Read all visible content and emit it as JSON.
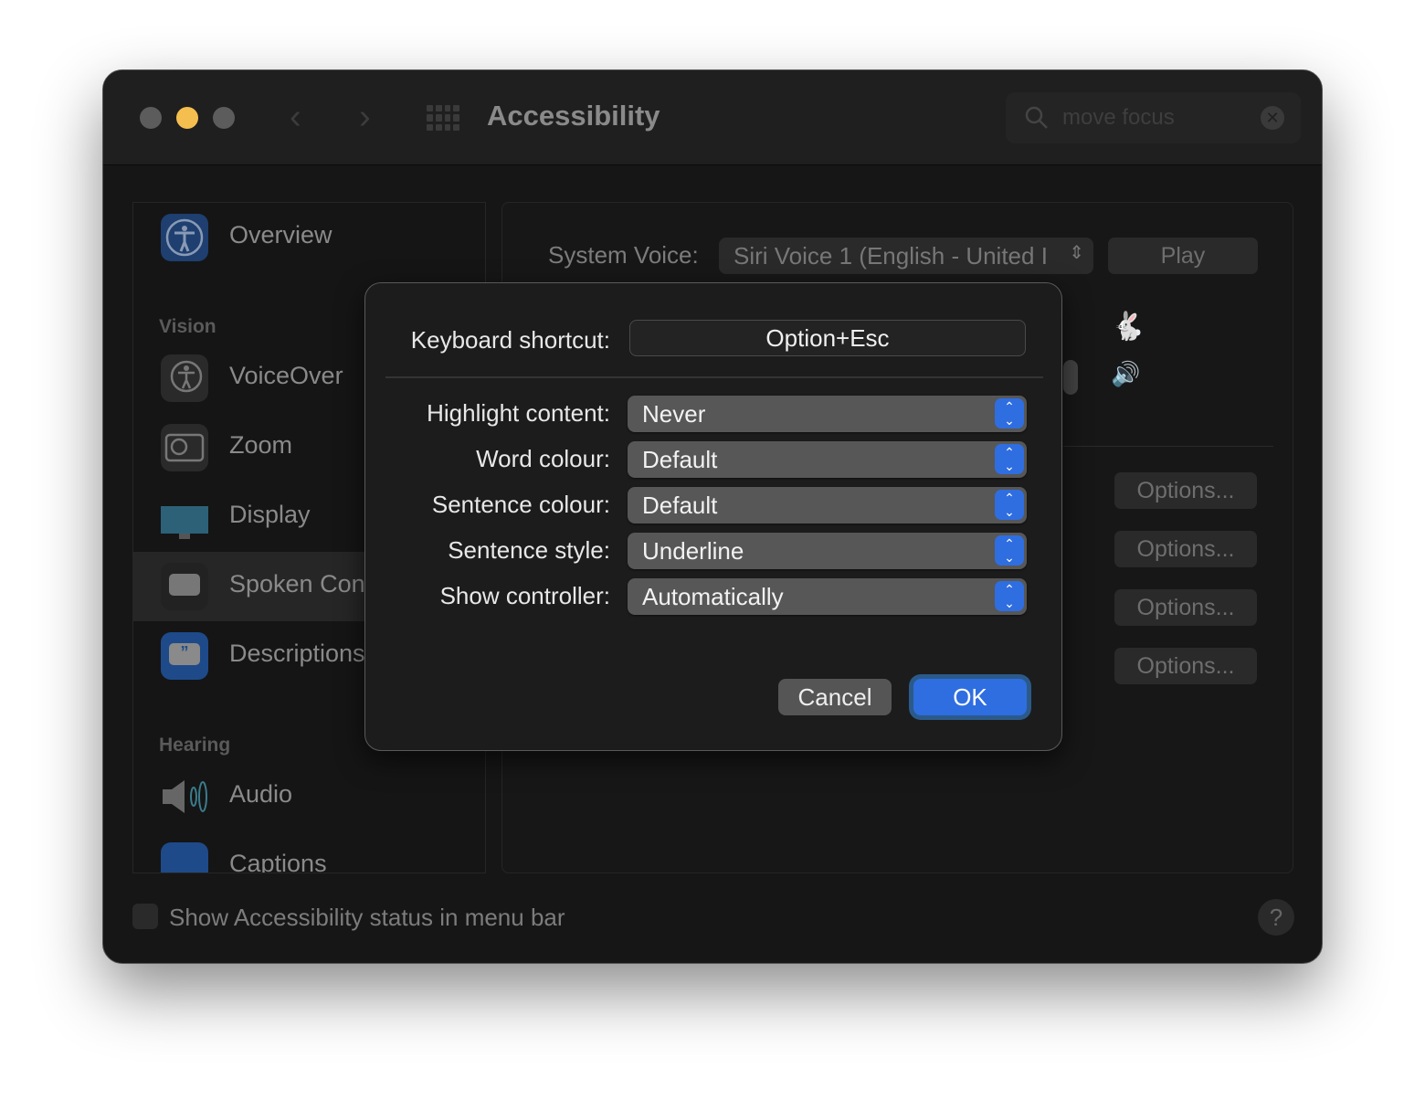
{
  "window": {
    "title": "Accessibility",
    "search": {
      "value": "move focus"
    }
  },
  "sidebar": {
    "items": [
      {
        "label": "Overview",
        "icon": "accessibility-icon"
      },
      {
        "label": "VoiceOver",
        "icon": "voiceover-icon"
      },
      {
        "label": "Zoom",
        "icon": "zoom-icon"
      },
      {
        "label": "Display",
        "icon": "display-icon"
      },
      {
        "label": "Spoken Con",
        "icon": "spoken-content-icon",
        "selected": true
      },
      {
        "label": "Descriptions",
        "icon": "descriptions-icon"
      },
      {
        "label": "Audio",
        "icon": "audio-icon"
      },
      {
        "label": "Captions",
        "icon": "captions-icon"
      }
    ],
    "sections": {
      "vision": "Vision",
      "hearing": "Hearing"
    }
  },
  "main": {
    "system_voice_label": "System Voice:",
    "system_voice_value": "Siri Voice 1 (English - United I",
    "play": "Play",
    "options": [
      "Options...",
      "Options...",
      "Options...",
      "Options..."
    ]
  },
  "footer": {
    "status_checkbox": "Show Accessibility status in menu bar",
    "checked": false,
    "help": "?"
  },
  "dialog": {
    "shortcut_label": "Keyboard shortcut:",
    "shortcut_value": "Option+Esc",
    "rows": [
      {
        "label": "Highlight content:",
        "value": "Never"
      },
      {
        "label": "Word colour:",
        "value": "Default"
      },
      {
        "label": "Sentence colour:",
        "value": "Default"
      },
      {
        "label": "Sentence style:",
        "value": "Underline"
      },
      {
        "label": "Show controller:",
        "value": "Automatically"
      }
    ],
    "cancel": "Cancel",
    "ok": "OK"
  },
  "colors": {
    "accent": "#2f6ee0",
    "close_dot": "#5c5c5c",
    "minimize_dot": "#f5bf4f"
  }
}
